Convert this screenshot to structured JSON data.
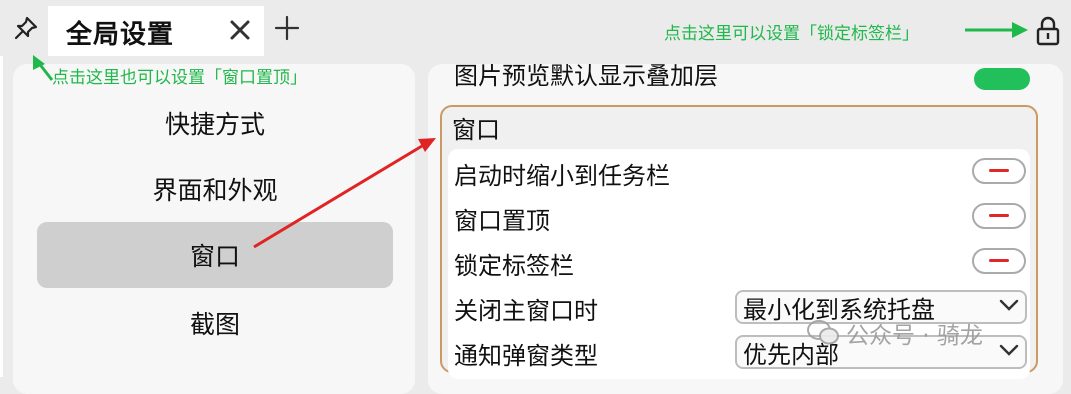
{
  "tabbar": {
    "tab_title": "全局设置",
    "close_glyph": "✕",
    "new_tab_glyph": "+",
    "hint_lock": "点击这里可以设置「锁定标签栏」",
    "hint_pin": "点击这里也可以设置「窗口置顶」"
  },
  "sidebar": {
    "items": [
      {
        "label": "快捷方式",
        "active": false
      },
      {
        "label": "界面和外观",
        "active": false
      },
      {
        "label": "窗口",
        "active": true
      },
      {
        "label": "截图",
        "active": false
      }
    ]
  },
  "main": {
    "previous_row_label": "图片预览默认显示叠加层",
    "previous_row_toggle": "on",
    "section": {
      "title": "窗口",
      "rows": [
        {
          "label": "启动时缩小到任务栏",
          "control": "toggle",
          "state": "off"
        },
        {
          "label": "窗口置顶",
          "control": "toggle",
          "state": "off"
        },
        {
          "label": "锁定标签栏",
          "control": "toggle",
          "state": "off"
        },
        {
          "label": "关闭主窗口时",
          "control": "select",
          "value": "最小化到系统托盘"
        },
        {
          "label": "通知弹窗类型",
          "control": "select",
          "value": "优先内部"
        }
      ]
    }
  },
  "watermark": "公众号 · 骑龙",
  "icons": {
    "pin": "pin-icon",
    "close": "close-icon",
    "new_tab": "plus-icon",
    "lock": "lock-icon",
    "select_arrow": "chevron-down-icon",
    "watermark": "wechat-icon"
  },
  "colors": {
    "hint_green": "#1fb84a",
    "annotation_red": "#e02424",
    "section_border": "#c99a63",
    "toggle_on": "#22c05a",
    "toggle_off_mark": "#e02828"
  }
}
